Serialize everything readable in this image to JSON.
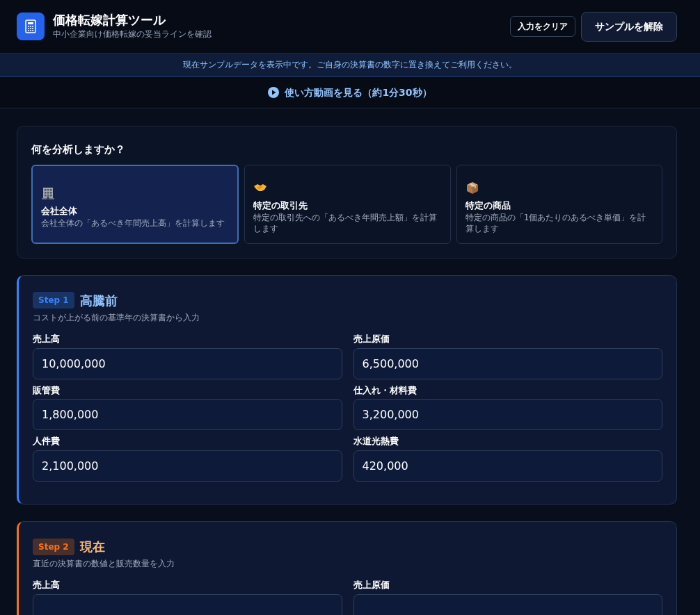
{
  "header": {
    "title": "価格転嫁計算ツール",
    "subtitle": "中小企業向け価格転嫁の妥当ラインを確認",
    "buttons": [
      {
        "label": "入力をクリア",
        "kind": "outline"
      },
      {
        "label": "サンプルを解除",
        "kind": "filled"
      }
    ]
  },
  "notice": "現在サンプルデータを表示中です。ご自身の決算書の数字に置き換えてご利用ください。",
  "video_link": "使い方動画を見る（約1分30秒）",
  "analysis": {
    "title": "何を分析しますか？",
    "options": [
      {
        "kind": "building",
        "title": "会社全体",
        "description": "会社全体の「あるべき年間売上高」を計算します",
        "selected": true
      },
      {
        "kind": "handshake",
        "title": "特定の取引先",
        "description": "特定の取引先への「あるべき年間売上額」を計算します",
        "selected": false
      },
      {
        "kind": "package",
        "title": "特定の商品",
        "description": "特定の商品の「1個あたりのあるべき単価」を計算します",
        "selected": false
      }
    ]
  },
  "steps": [
    {
      "badge": "Step 1",
      "title": "高騰前",
      "description": "コストが上がる前の基準年の決算書から入力",
      "color": "#3b82f6",
      "fields": [
        {
          "label": "売上高",
          "value": "10,000,000"
        },
        {
          "label": "売上原価",
          "value": "6,500,000"
        },
        {
          "label": "販管費",
          "value": "1,800,000"
        },
        {
          "label": "仕入れ・材料費",
          "value": "3,200,000"
        },
        {
          "label": "人件費",
          "value": "2,100,000"
        },
        {
          "label": "水道光熱費",
          "value": "420,000"
        }
      ]
    },
    {
      "badge": "Step 2",
      "title": "現在",
      "description": "直近の決算書の数値と販売数量を入力",
      "color": "#f97316",
      "fields": [
        {
          "label": "売上高"
        },
        {
          "label": "売上原価"
        }
      ]
    }
  ]
}
